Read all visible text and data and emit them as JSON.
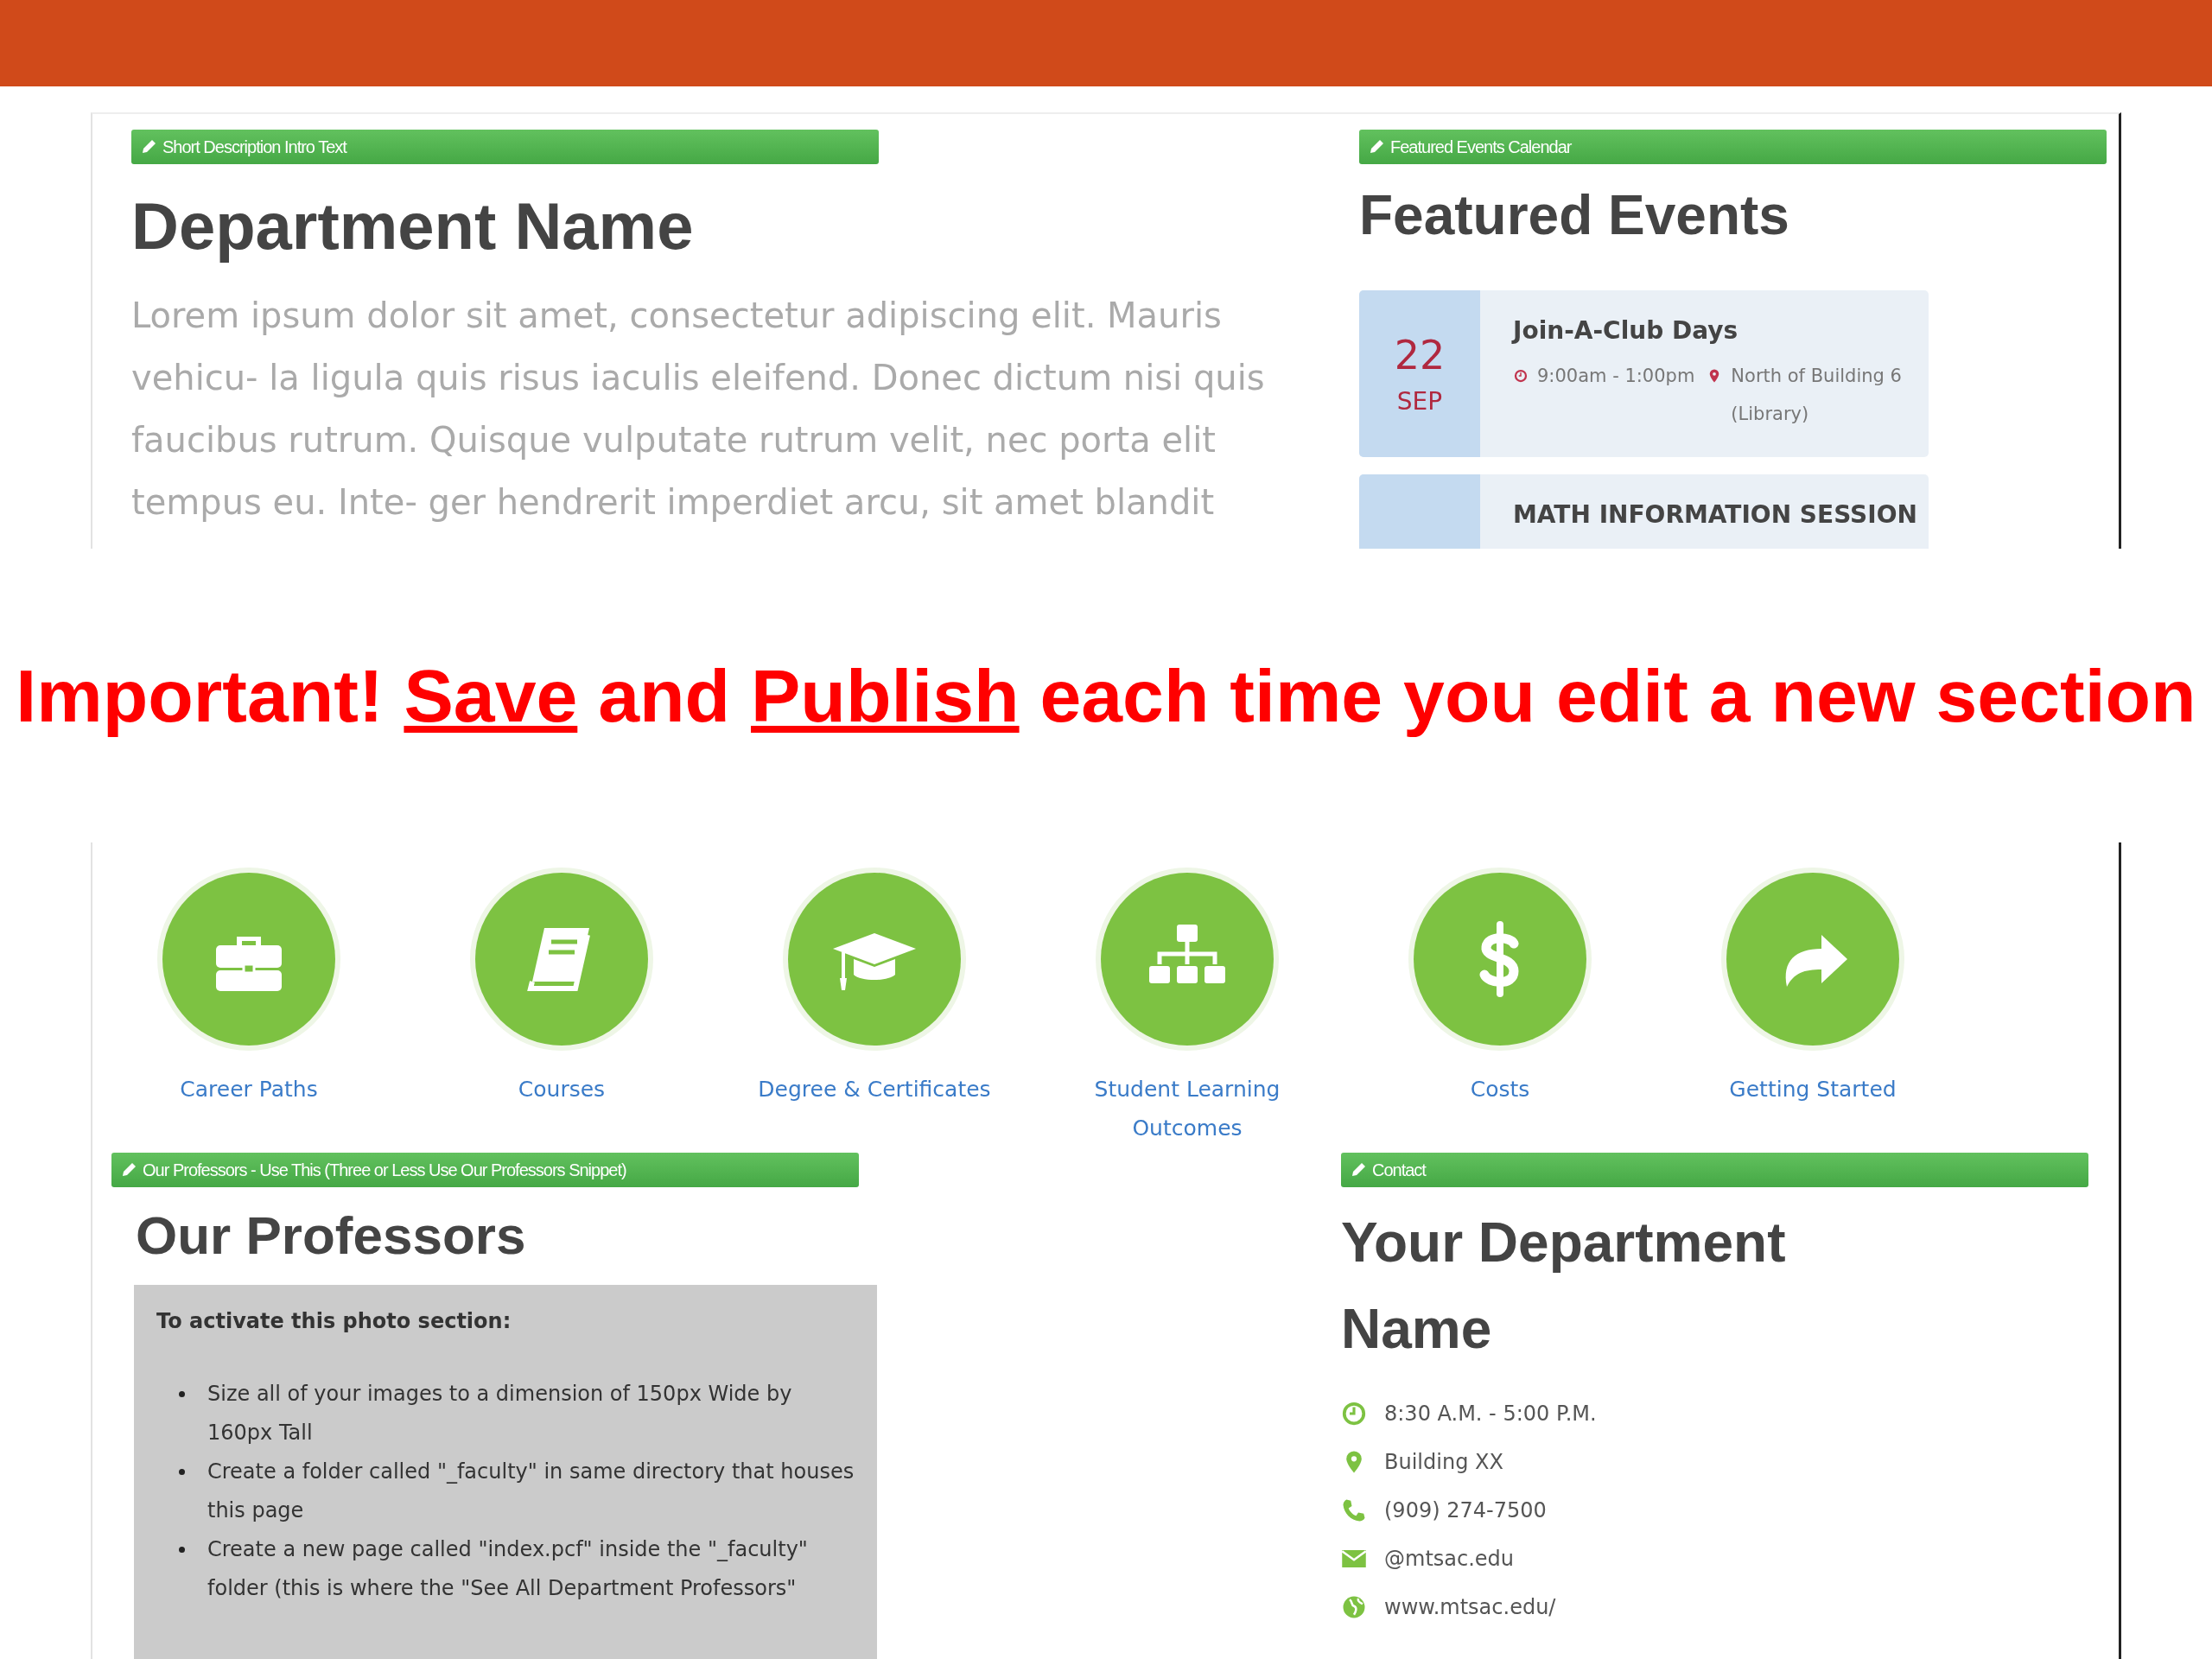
{
  "top_panel": {
    "intro": {
      "tag": "Short Description Intro Text",
      "heading": "Department Name",
      "paragraph": "Lorem ipsum dolor sit amet, consectetur adipiscing elit. Mauris vehicu- la ligula quis risus iaculis eleifend. Donec dictum nisi quis faucibus rutrum. Quisque vulputate rutrum velit, nec porta elit tempus eu. Inte- ger hendrerit imperdiet arcu, sit amet blandit"
    },
    "events": {
      "tag": "Featured Events Calendar",
      "heading": "Featured Events",
      "items": [
        {
          "day": "22",
          "month": "SEP",
          "title": "Join-A-Club Days",
          "time": "9:00am - 1:00pm",
          "location": "North of Building 6 (Library)"
        },
        {
          "title": "MATH INFORMATION SESSION"
        }
      ]
    }
  },
  "notice": {
    "parts": [
      {
        "text": "Important! ",
        "underline": false
      },
      {
        "text": "Save",
        "underline": true
      },
      {
        "text": " and ",
        "underline": false
      },
      {
        "text": "Publish",
        "underline": true
      },
      {
        "text": " each time you edit a new section",
        "underline": false
      }
    ]
  },
  "bottom_panel": {
    "links": [
      {
        "kind": "briefcase",
        "label": "Career Paths"
      },
      {
        "kind": "book",
        "label": "Courses"
      },
      {
        "kind": "cap",
        "label": "Degree & Certificates"
      },
      {
        "kind": "sitemap",
        "label": "Student Learning Outcomes"
      },
      {
        "kind": "dollar",
        "label": "Costs"
      },
      {
        "kind": "share",
        "label": "Getting Started"
      }
    ],
    "professors": {
      "tag": "Our Professors - Use This (Three or Less Use Our Professors Snippet)",
      "heading": "Our Professors",
      "instructions_title": "To activate this photo section:",
      "bullets": [
        "Size all of your images to a dimension of 150px Wide by 160px Tall",
        "Create a folder called \"_faculty\" in same directory that houses this page",
        "Create a new page called \"index.pcf\" inside the \"_faculty\" folder (this is where the \"See All Department Professors\""
      ]
    },
    "contact": {
      "tag": "Contact",
      "heading": "Your Department Name",
      "items": [
        {
          "kind": "clock",
          "text": "8:30 A.M. - 5:00 P.M."
        },
        {
          "kind": "pin",
          "text": "Building XX"
        },
        {
          "kind": "phone",
          "text": "(909) 274-7500"
        },
        {
          "kind": "mail",
          "text": "@mtsac.edu"
        },
        {
          "kind": "globe",
          "text": "www.mtsac.edu/"
        }
      ]
    }
  }
}
